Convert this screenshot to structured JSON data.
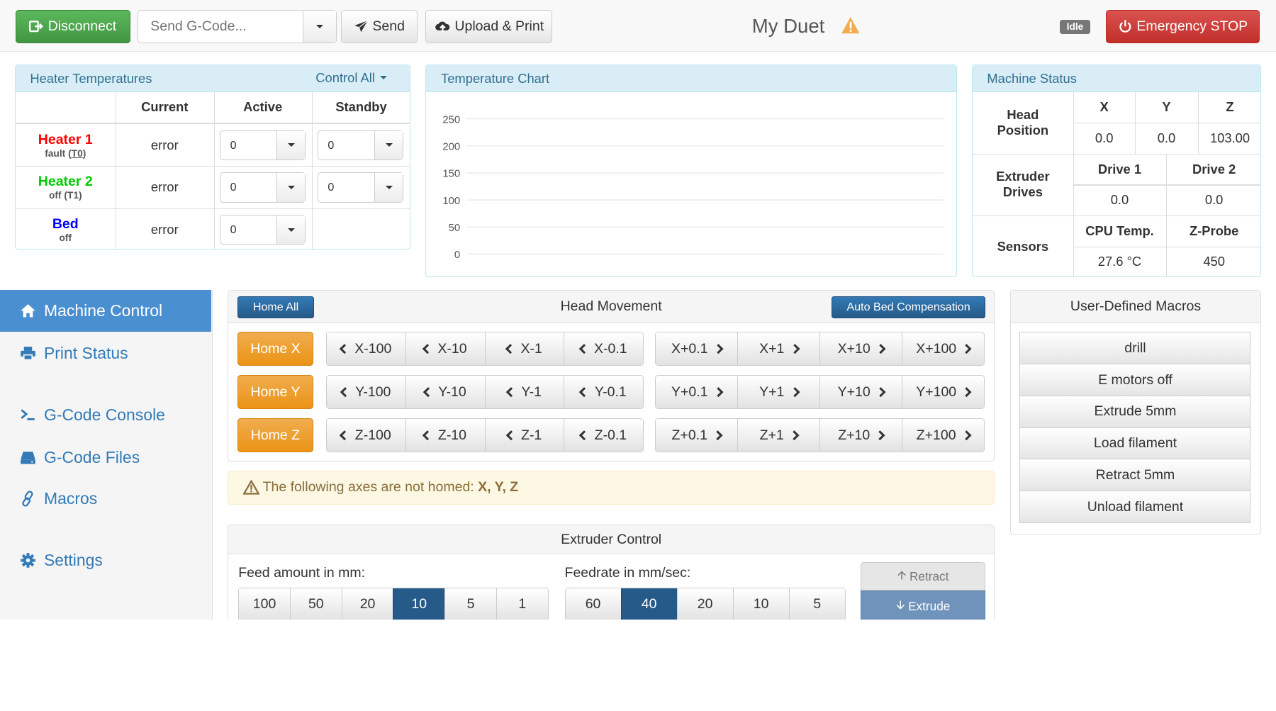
{
  "header": {
    "disconnect_label": "Disconnect",
    "gcode_placeholder": "Send G-Code...",
    "send_label": "Send",
    "upload_label": "Upload & Print",
    "title": "My Duet",
    "status_badge": "Idle",
    "estop_label": "Emergency STOP"
  },
  "heaters": {
    "title": "Heater Temperatures",
    "control_all": "Control All",
    "col_current": "Current",
    "col_active": "Active",
    "col_standby": "Standby",
    "rows": [
      {
        "name": "Heater 1",
        "name_color": "#ff0000",
        "status_prefix": "fault (",
        "status_tool": "T0",
        "status_suffix": ")",
        "current": "error",
        "active": "0",
        "standby": "0"
      },
      {
        "name": "Heater 2",
        "name_color": "#00cc00",
        "status": "off (T1)",
        "current": "error",
        "active": "0",
        "standby": "0"
      },
      {
        "name": "Bed",
        "name_color": "#0000ff",
        "status": "off",
        "current": "error",
        "active": "0"
      }
    ]
  },
  "chart": {
    "title": "Temperature Chart"
  },
  "chart_data": {
    "type": "line",
    "title": "Temperature Chart",
    "xlabel": "",
    "ylabel": "",
    "ylim": [
      0,
      250
    ],
    "yticks": [
      250,
      200,
      150,
      100,
      50,
      0
    ],
    "series": []
  },
  "machine_status": {
    "title": "Machine Status",
    "head_position_label": "Head Position",
    "axes": [
      "X",
      "Y",
      "Z"
    ],
    "position": [
      "0.0",
      "0.0",
      "103.00"
    ],
    "extruder_label": "Extruder Drives",
    "drives": [
      "Drive 1",
      "Drive 2"
    ],
    "drive_values": [
      "0.0",
      "0.0"
    ],
    "sensors_label": "Sensors",
    "sensor_headers": [
      "CPU Temp.",
      "Z-Probe"
    ],
    "sensor_values": [
      "27.6 °C",
      "450"
    ]
  },
  "sidebar": {
    "items": [
      {
        "label": "Machine Control",
        "icon": "home-icon",
        "active": true
      },
      {
        "label": "Print Status",
        "icon": "printer-icon"
      },
      {
        "label": "G-Code Console",
        "icon": "terminal-icon"
      },
      {
        "label": "G-Code Files",
        "icon": "drive-icon"
      },
      {
        "label": "Macros",
        "icon": "link-icon"
      },
      {
        "label": "Settings",
        "icon": "gear-icon"
      }
    ]
  },
  "head_movement": {
    "title": "Head Movement",
    "home_all": "Home All",
    "auto_bed": "Auto Bed Compensation",
    "rows": [
      {
        "home": "Home X",
        "minus": [
          "X-100",
          "X-10",
          "X-1",
          "X-0.1"
        ],
        "plus": [
          "X+0.1",
          "X+1",
          "X+10",
          "X+100"
        ]
      },
      {
        "home": "Home Y",
        "minus": [
          "Y-100",
          "Y-10",
          "Y-1",
          "Y-0.1"
        ],
        "plus": [
          "Y+0.1",
          "Y+1",
          "Y+10",
          "Y+100"
        ]
      },
      {
        "home": "Home Z",
        "minus": [
          "Z-100",
          "Z-10",
          "Z-1",
          "Z-0.1"
        ],
        "plus": [
          "Z+0.1",
          "Z+1",
          "Z+10",
          "Z+100"
        ]
      }
    ]
  },
  "warning": {
    "text": "The following axes are not homed: ",
    "axes": "X, Y, Z",
    "bg": "#fcf8e3",
    "color": "#8a6d3b"
  },
  "macros": {
    "title": "User-Defined Macros",
    "items": [
      "drill",
      "E motors off",
      "Extrude 5mm",
      "Load filament",
      "Retract 5mm",
      "Unload filament"
    ]
  },
  "extruder": {
    "title": "Extruder Control",
    "feed_label": "Feed amount in mm:",
    "feed_options": [
      "100",
      "50",
      "20",
      "10",
      "5",
      "1"
    ],
    "feed_selected": "10",
    "rate_label": "Feedrate in mm/sec:",
    "rate_options": [
      "60",
      "40",
      "20",
      "10",
      "5"
    ],
    "rate_selected": "40",
    "retract_label": "Retract",
    "extrude_label": "Extrude"
  },
  "colors": {
    "accent": "#337ab7",
    "success": "#449d44",
    "danger": "#d9534f",
    "warning": "#f0ad4e",
    "info_bg": "#d9edf7"
  }
}
